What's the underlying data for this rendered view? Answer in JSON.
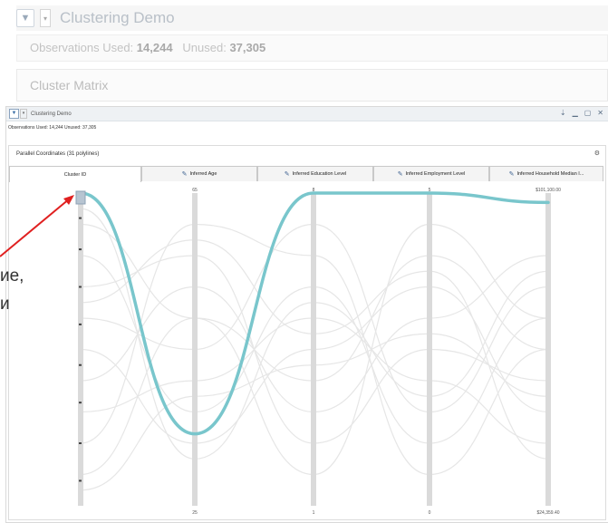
{
  "background_window": {
    "title": "Clustering Demo",
    "observations_used_label": "Observations Used:",
    "observations_used_value": "14,244",
    "unused_label": "Unused:",
    "unused_value": "37,305",
    "section_title": "Cluster Matrix"
  },
  "window": {
    "title": "Clustering Demo",
    "observations_text": "Observations Used: 14,244 Unused: 37,305",
    "controls": [
      "⇣",
      "▁",
      "▢",
      "✕"
    ]
  },
  "panel": {
    "title": "Parallel Coordinates (31 polylines)",
    "tabs": [
      {
        "label": "Cluster ID",
        "icon": "",
        "active": true
      },
      {
        "label": "Inferred Age",
        "icon": "pencil-icon",
        "active": false
      },
      {
        "label": "Inferred Education Level",
        "icon": "pencil-icon",
        "active": false
      },
      {
        "label": "Inferred Employment Level",
        "icon": "pencil-icon",
        "active": false
      },
      {
        "label": "Inferred Household Median I...",
        "icon": "pencil-icon",
        "active": false
      }
    ]
  },
  "chart_data": {
    "type": "parallel-coordinates",
    "axes": [
      {
        "name": "Cluster ID",
        "top_label": "",
        "bottom_label": ""
      },
      {
        "name": "Inferred Age",
        "top_label": "65",
        "bottom_label": "25"
      },
      {
        "name": "Inferred Education Level",
        "top_label": "8",
        "bottom_label": "1"
      },
      {
        "name": "Inferred Employment Level",
        "top_label": "5",
        "bottom_label": "0"
      },
      {
        "name": "Inferred Household Median Income",
        "top_label": "$101,100.00",
        "bottom_label": "$24,359.40"
      }
    ],
    "highlighted_polyline": {
      "color": "#79c6cc",
      "values": [
        1.0,
        0.23,
        1.0,
        1.0,
        0.97
      ]
    },
    "background_polyline_color": "#e6e6e6",
    "polyline_count": 31
  },
  "annotation": {
    "text_lines": [
      "ие,",
      "и"
    ],
    "arrow_color": "#e02020"
  }
}
